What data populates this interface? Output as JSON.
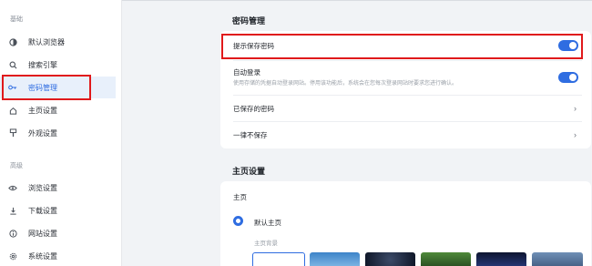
{
  "sidebar": {
    "section_basic": "基础",
    "section_advanced": "高级",
    "items": [
      {
        "label": "默认浏览器",
        "icon": "browser-icon"
      },
      {
        "label": "搜索引擎",
        "icon": "search-icon"
      },
      {
        "label": "密码管理",
        "icon": "key-icon",
        "active": true
      },
      {
        "label": "主页设置",
        "icon": "home-icon"
      },
      {
        "label": "外观设置",
        "icon": "appearance-icon"
      },
      {
        "label": "浏览设置",
        "icon": "eye-icon"
      },
      {
        "label": "下载设置",
        "icon": "download-icon"
      },
      {
        "label": "网站设置",
        "icon": "info-icon"
      },
      {
        "label": "系统设置",
        "icon": "gear-icon"
      }
    ]
  },
  "password": {
    "title": "密码管理",
    "offer_save": {
      "label": "提示保存密码",
      "enabled": true
    },
    "auto_login": {
      "label": "自动登录",
      "desc": "使用存储的凭据自动登录网站。停用该功能后，系统会在您每次登录网站时要求您进行确认。",
      "enabled": true
    },
    "saved_passwords": {
      "label": "已保存的密码"
    },
    "never_saved": {
      "label": "一律不保存"
    }
  },
  "homepage": {
    "title": "主页设置",
    "section_label": "主页",
    "option_default": "默认主页",
    "background_label": "主页背景"
  },
  "colors": {
    "accent": "#2f6de1",
    "highlight": "#e0191b"
  }
}
